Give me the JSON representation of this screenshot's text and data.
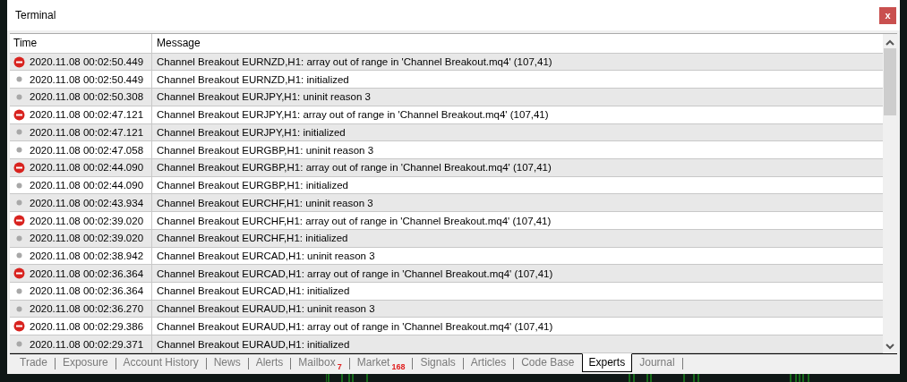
{
  "window": {
    "title": "Terminal",
    "close": "x"
  },
  "table": {
    "columns": [
      "Time",
      "Message"
    ],
    "rows": [
      {
        "kind": "error",
        "time": "2020.11.08 00:02:50.449",
        "message": "Channel Breakout EURNZD,H1: array out of range in 'Channel Breakout.mq4' (107,41)"
      },
      {
        "kind": "info",
        "time": "2020.11.08 00:02:50.449",
        "message": "Channel Breakout EURNZD,H1: initialized"
      },
      {
        "kind": "info",
        "time": "2020.11.08 00:02:50.308",
        "message": "Channel Breakout EURJPY,H1: uninit reason 3"
      },
      {
        "kind": "error",
        "time": "2020.11.08 00:02:47.121",
        "message": "Channel Breakout EURJPY,H1: array out of range in 'Channel Breakout.mq4' (107,41)"
      },
      {
        "kind": "info",
        "time": "2020.11.08 00:02:47.121",
        "message": "Channel Breakout EURJPY,H1: initialized"
      },
      {
        "kind": "info",
        "time": "2020.11.08 00:02:47.058",
        "message": "Channel Breakout EURGBP,H1: uninit reason 3"
      },
      {
        "kind": "error",
        "time": "2020.11.08 00:02:44.090",
        "message": "Channel Breakout EURGBP,H1: array out of range in 'Channel Breakout.mq4' (107,41)"
      },
      {
        "kind": "info",
        "time": "2020.11.08 00:02:44.090",
        "message": "Channel Breakout EURGBP,H1: initialized"
      },
      {
        "kind": "info",
        "time": "2020.11.08 00:02:43.934",
        "message": "Channel Breakout EURCHF,H1: uninit reason 3"
      },
      {
        "kind": "error",
        "time": "2020.11.08 00:02:39.020",
        "message": "Channel Breakout EURCHF,H1: array out of range in 'Channel Breakout.mq4' (107,41)"
      },
      {
        "kind": "info",
        "time": "2020.11.08 00:02:39.020",
        "message": "Channel Breakout EURCHF,H1: initialized"
      },
      {
        "kind": "info",
        "time": "2020.11.08 00:02:38.942",
        "message": "Channel Breakout EURCAD,H1: uninit reason 3"
      },
      {
        "kind": "error",
        "time": "2020.11.08 00:02:36.364",
        "message": "Channel Breakout EURCAD,H1: array out of range in 'Channel Breakout.mq4' (107,41)"
      },
      {
        "kind": "info",
        "time": "2020.11.08 00:02:36.364",
        "message": "Channel Breakout EURCAD,H1: initialized"
      },
      {
        "kind": "info",
        "time": "2020.11.08 00:02:36.270",
        "message": "Channel Breakout EURAUD,H1: uninit reason 3"
      },
      {
        "kind": "error",
        "time": "2020.11.08 00:02:29.386",
        "message": "Channel Breakout EURAUD,H1: array out of range in 'Channel Breakout.mq4' (107,41)"
      },
      {
        "kind": "info",
        "time": "2020.11.08 00:02:29.371",
        "message": "Channel Breakout EURAUD,H1: initialized"
      }
    ]
  },
  "tabs": [
    {
      "label": "Trade",
      "selected": false
    },
    {
      "label": "Exposure",
      "selected": false
    },
    {
      "label": "Account History",
      "selected": false
    },
    {
      "label": "News",
      "selected": false
    },
    {
      "label": "Alerts",
      "selected": false
    },
    {
      "label": "Mailbox",
      "badge": "7",
      "selected": false
    },
    {
      "label": "Market",
      "badge": "168",
      "selected": false
    },
    {
      "label": "Signals",
      "selected": false
    },
    {
      "label": "Articles",
      "selected": false
    },
    {
      "label": "Code Base",
      "selected": false
    },
    {
      "label": "Experts",
      "selected": true
    },
    {
      "label": "Journal",
      "selected": false
    }
  ]
}
